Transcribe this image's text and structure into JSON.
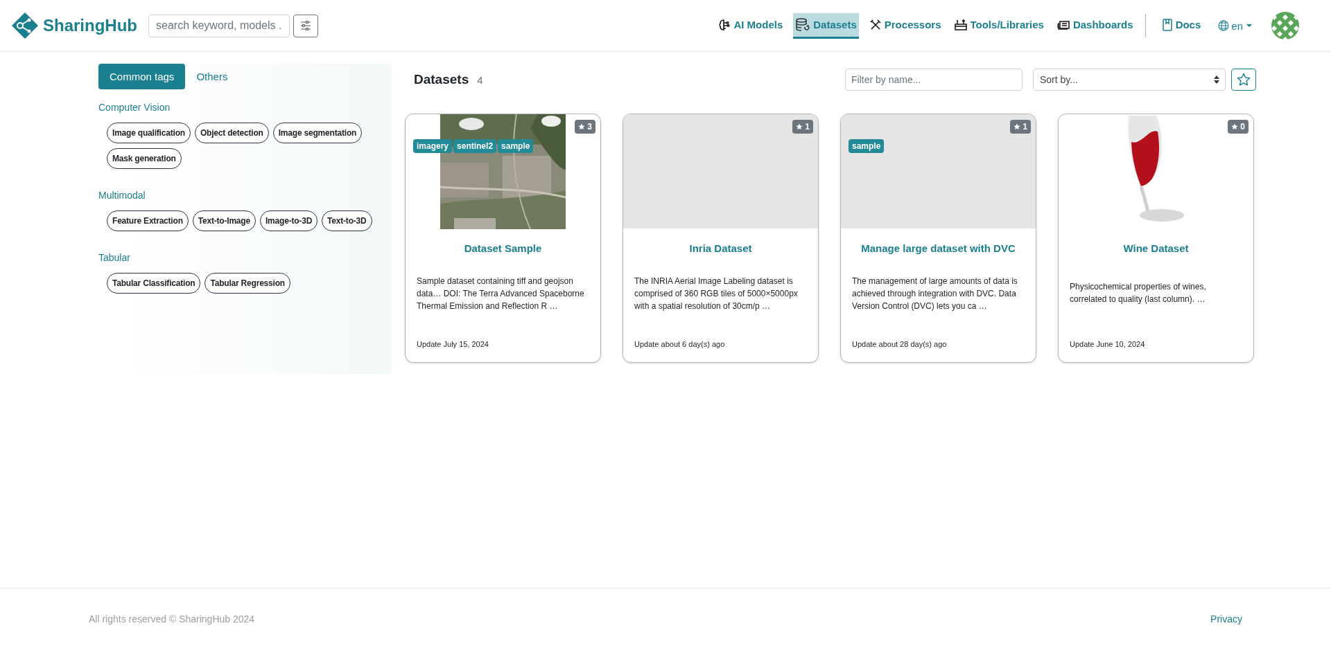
{
  "header": {
    "logo": "SharingHub",
    "search": {
      "placeholder": "search keyword, models ."
    },
    "nav": [
      {
        "label": "AI Models",
        "selected": false
      },
      {
        "label": "Datasets",
        "selected": true
      },
      {
        "label": "Processors",
        "selected": false
      },
      {
        "label": "Tools/Libraries",
        "selected": false
      },
      {
        "label": "Dashboards",
        "selected": false
      }
    ],
    "docs": "Docs",
    "language": "en"
  },
  "sidebar": {
    "tabs": [
      {
        "label": "Common tags",
        "selected": true
      },
      {
        "label": "Others",
        "selected": false
      }
    ],
    "groups": [
      {
        "title": "Computer Vision",
        "tags": [
          "Image qualification",
          "Object detection",
          "Image segmentation",
          "Mask generation"
        ]
      },
      {
        "title": "Multimodal",
        "tags": [
          "Feature Extraction",
          "Text-to-Image",
          "Image-to-3D",
          "Text-to-3D"
        ]
      },
      {
        "title": "Tabular",
        "tags": [
          "Tabular Classification",
          "Tabular Regression"
        ]
      }
    ]
  },
  "main": {
    "title": "Datasets",
    "count": "4",
    "filter": {
      "placeholder": "Filter by name..."
    },
    "sort": {
      "placeholder": "Sort by..."
    },
    "cards": [
      {
        "kind": "picture",
        "stars": "3",
        "tags": [
          "imagery",
          "sentinel2",
          "sample"
        ],
        "title": "Dataset Sample",
        "description": "Sample dataset containing tiff and geojson data… DOI: The Terra Advanced Spaceborne Thermal Emission and Reflection R …",
        "updated": "Update July 15, 2024"
      },
      {
        "kind": "blank",
        "stars": "1",
        "title": "Inria Dataset",
        "description": "The INRIA Aerial Image Labeling dataset is comprised of 360 RGB tiles of 5000×5000px with a spatial resolution of 30cm/p …",
        "updated": "Update about 6 day(s) ago"
      },
      {
        "kind": "blank",
        "stars": "1",
        "tags": [
          "sample"
        ],
        "title": "Manage large dataset with DVC",
        "description": "The management of large amounts of data is achieved through integration with DVC. Data Version Control (DVC) lets you ca …",
        "updated": "Update about 28 day(s) ago"
      },
      {
        "kind": "drawing",
        "stars": "0",
        "title": "Wine Dataset",
        "description": "Physicochemical properties of wines, correlated to quality (last column). …",
        "updated": "Update June 10, 2024"
      }
    ]
  },
  "footer": {
    "copyright": "All rights reserved © SharingHub 2024",
    "privacy": "Privacy"
  }
}
